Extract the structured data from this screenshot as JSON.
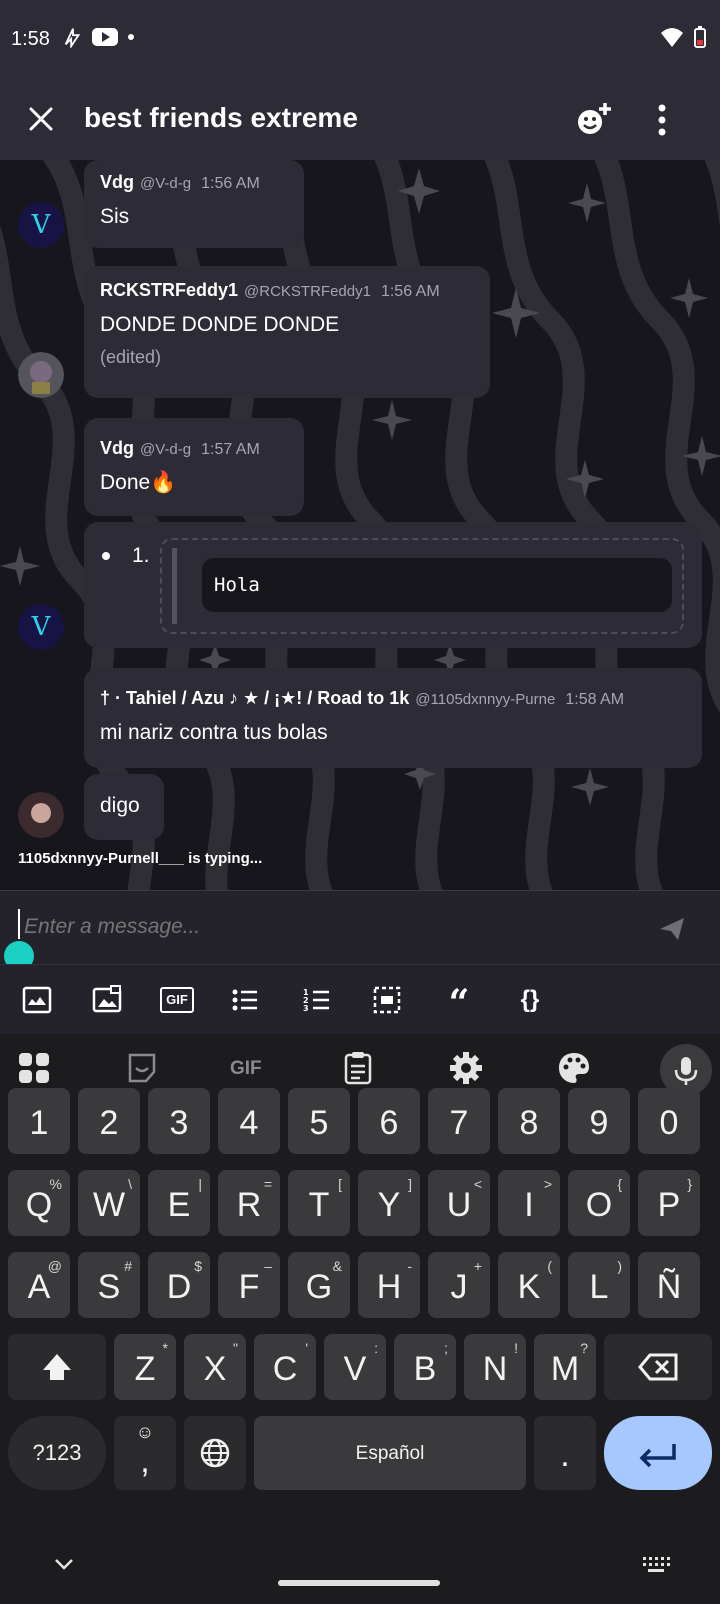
{
  "status_bar": {
    "time": "1:58",
    "icons": [
      "flash-icon",
      "youtube-icon",
      "dot-icon",
      "wifi-icon",
      "battery-low-icon"
    ]
  },
  "app_bar": {
    "title": "best friends extreme",
    "actions": [
      "close-icon",
      "add-member-icon",
      "more-vert-icon"
    ]
  },
  "messages": [
    {
      "name": "Vdg",
      "handle": "@V-d-g",
      "time": "1:56 AM",
      "text": "Sis",
      "avatar": "V"
    },
    {
      "name": "RCKSTRFeddy1",
      "handle": "@RCKSTRFeddy1",
      "time": "1:56 AM",
      "text": "DONDE DONDE DONDE",
      "note": "(edited)"
    },
    {
      "name": "Vdg",
      "handle": "@V-d-g",
      "time": "1:57 AM",
      "text": "Done🔥",
      "avatar": "V"
    },
    {
      "list_marker": "1.",
      "code": "Hola"
    },
    {
      "name": "† · Tahiel / Azu ♪ ★ / ¡★! / Road to 1k",
      "handle": "@1105dxnnyy-Purne",
      "time": "1:58 AM",
      "text": "mi nariz contra tus bolas"
    },
    {
      "text": "digo"
    }
  ],
  "typing_indicator": "1105dxnnyy-Purnell___ is typing...",
  "composer": {
    "placeholder": "Enter a message..."
  },
  "format_bar": {
    "items": [
      "sticker-icon",
      "image-icon",
      "gif-icon",
      "bullet-list-icon",
      "numbered-list-icon",
      "spoiler-icon",
      "quote-icon",
      "code-icon"
    ],
    "gif_label": "GIF",
    "quote_label": "“",
    "code_label": "{}"
  },
  "keyboard": {
    "toolbar": [
      "apps-grid-icon",
      "sticker-icon",
      "gif-icon",
      "clipboard-icon",
      "settings-icon",
      "palette-icon",
      "mic-icon"
    ],
    "toolbar_gif": "GIF",
    "row_numbers": [
      "1",
      "2",
      "3",
      "4",
      "5",
      "6",
      "7",
      "8",
      "9",
      "0"
    ],
    "row1": [
      [
        "Q",
        "%"
      ],
      [
        "W",
        "\\"
      ],
      [
        "E",
        "|"
      ],
      [
        "R",
        "="
      ],
      [
        "T",
        "["
      ],
      [
        "Y",
        "]"
      ],
      [
        "U",
        "<"
      ],
      [
        "I",
        ">"
      ],
      [
        "O",
        "{"
      ],
      [
        "P",
        "}"
      ]
    ],
    "row2": [
      [
        "A",
        "@"
      ],
      [
        "S",
        "#"
      ],
      [
        "D",
        "$"
      ],
      [
        "F",
        "–"
      ],
      [
        "G",
        "&"
      ],
      [
        "H",
        "-"
      ],
      [
        "J",
        "+"
      ],
      [
        "K",
        "("
      ],
      [
        "L",
        ")"
      ],
      [
        "Ñ",
        ""
      ]
    ],
    "row3": [
      [
        "Z",
        "*"
      ],
      [
        "X",
        "\""
      ],
      [
        "C",
        "'"
      ],
      [
        "V",
        ":"
      ],
      [
        "B",
        ";"
      ],
      [
        "N",
        "!"
      ],
      [
        "M",
        "?"
      ]
    ],
    "symbols_key": "?123",
    "comma_key": ",",
    "emoji_hint": "☺",
    "space_label": "Español",
    "period_key": "."
  }
}
